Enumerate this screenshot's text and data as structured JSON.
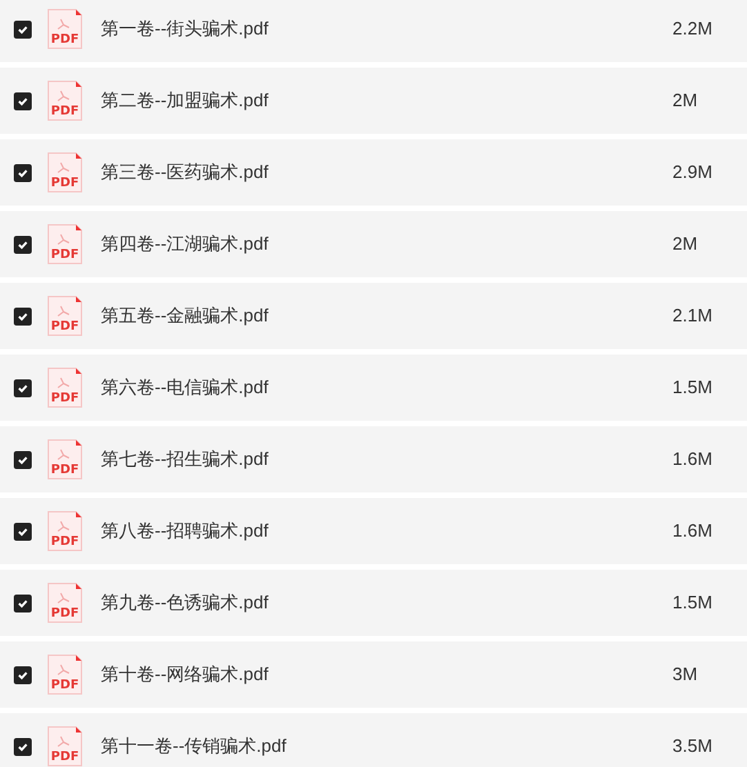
{
  "files": [
    {
      "icon_label": "PDF",
      "name": "第一卷--街头骗术.pdf",
      "size": "2.2M",
      "checked": true
    },
    {
      "icon_label": "PDF",
      "name": "第二卷--加盟骗术.pdf",
      "size": "2M",
      "checked": true
    },
    {
      "icon_label": "PDF",
      "name": "第三卷--医药骗术.pdf",
      "size": "2.9M",
      "checked": true
    },
    {
      "icon_label": "PDF",
      "name": "第四卷--江湖骗术.pdf",
      "size": "2M",
      "checked": true
    },
    {
      "icon_label": "PDF",
      "name": "第五卷--金融骗术.pdf",
      "size": "2.1M",
      "checked": true
    },
    {
      "icon_label": "PDF",
      "name": "第六卷--电信骗术.pdf",
      "size": "1.5M",
      "checked": true
    },
    {
      "icon_label": "PDF",
      "name": "第七卷--招生骗术.pdf",
      "size": "1.6M",
      "checked": true
    },
    {
      "icon_label": "PDF",
      "name": "第八卷--招聘骗术.pdf",
      "size": "1.6M",
      "checked": true
    },
    {
      "icon_label": "PDF",
      "name": "第九卷--色诱骗术.pdf",
      "size": "1.5M",
      "checked": true
    },
    {
      "icon_label": "PDF",
      "name": "第十卷--网络骗术.pdf",
      "size": "3M",
      "checked": true
    },
    {
      "icon_label": "PDF",
      "name": "第十一卷--传销骗术.pdf",
      "size": "3.5M",
      "checked": true
    }
  ]
}
